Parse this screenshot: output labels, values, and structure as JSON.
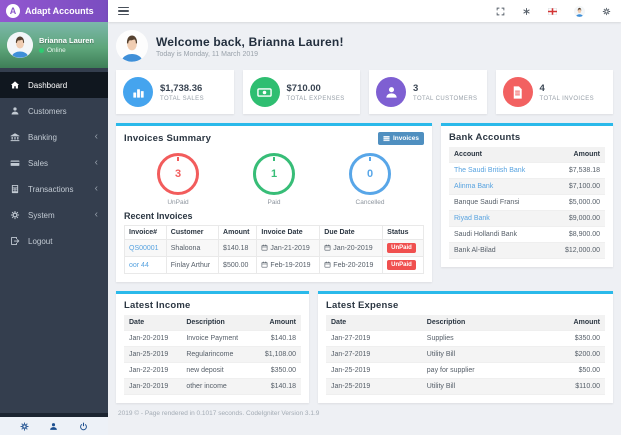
{
  "app": {
    "title": "Adapt Accounts"
  },
  "sidebar": {
    "user": {
      "name": "Brianna Lauren",
      "status": "Online"
    },
    "items": [
      {
        "label": "Dashboard"
      },
      {
        "label": "Customers"
      },
      {
        "label": "Banking",
        "chevron": "‹"
      },
      {
        "label": "Sales",
        "chevron": "‹"
      },
      {
        "label": "Transactions",
        "chevron": "‹"
      },
      {
        "label": "System",
        "chevron": "‹"
      },
      {
        "label": "Logout"
      }
    ],
    "footer_icons": [
      "gear-icon",
      "user-icon",
      "power-icon"
    ]
  },
  "topbar": {
    "icons": [
      "fullscreen-icon",
      "asterisk-icon",
      "flag-icon",
      "avatar-icon",
      "gear-icon"
    ]
  },
  "welcome": {
    "title": "Welcome back, Brianna Lauren!",
    "subtitle": "Today is Monday, 11 March 2019"
  },
  "stats": [
    {
      "value": "$1,738.36",
      "label": "TOTAL SALES",
      "color": "#45a4ee",
      "icon": "bar-chart-icon"
    },
    {
      "value": "$710.00",
      "label": "TOTAL EXPENSES",
      "color": "#2fbe71",
      "icon": "money-icon"
    },
    {
      "value": "3",
      "label": "TOTAL CUSTOMERS",
      "color": "#7e5fd2",
      "icon": "user-icon"
    },
    {
      "value": "4",
      "label": "TOTAL INVOICES",
      "color": "#f26161",
      "icon": "invoice-icon"
    }
  ],
  "invoices_summary": {
    "title": "Invoices Summary",
    "button_label": "Invoices",
    "dials": [
      {
        "value": "3",
        "label": "UnPaid",
        "color": "#f25c5c"
      },
      {
        "value": "1",
        "label": "Paid",
        "color": "#37bd77"
      },
      {
        "value": "0",
        "label": "Cancelled",
        "color": "#58a6e8"
      }
    ],
    "recent_title": "Recent Invoices",
    "headers": [
      "Invoice#",
      "Customer",
      "Amount",
      "Invoice Date",
      "Due Date",
      "Status"
    ],
    "rows": [
      {
        "invoice": "QS00001",
        "customer": "Shaloona",
        "amount": "$140.18",
        "invoice_date": "Jan-21-2019",
        "due_date": "Jan-20-2019",
        "status": "UnPaid"
      },
      {
        "invoice": "oor 44",
        "customer": "Finlay Arthur",
        "amount": "$500.00",
        "invoice_date": "Feb-19-2019",
        "due_date": "Feb-20-2019",
        "status": "UnPaid"
      }
    ]
  },
  "bank_accounts": {
    "title": "Bank Accounts",
    "headers": [
      "Account",
      "Amount"
    ],
    "rows": [
      {
        "account": "The Saudi British Bank",
        "amount": "$7,538.18"
      },
      {
        "account": "Alinma Bank",
        "amount": "$7,100.00"
      },
      {
        "account": "Banque Saudi Fransi",
        "amount": "$5,000.00"
      },
      {
        "account": "Riyad Bank",
        "amount": "$9,000.00"
      },
      {
        "account": "Saudi Hollandi Bank",
        "amount": "$8,900.00"
      },
      {
        "account": "Bank Al-Bilad",
        "amount": "$12,000.00"
      }
    ]
  },
  "latest_income": {
    "title": "Latest Income",
    "headers": [
      "Date",
      "Description",
      "Amount"
    ],
    "rows": [
      {
        "date": "Jan-20-2019",
        "description": "Invoice Payment",
        "amount": "$140.18"
      },
      {
        "date": "Jan-25-2019",
        "description": "Regularincome",
        "amount": "$1,108.00"
      },
      {
        "date": "Jan-22-2019",
        "description": "new deposit",
        "amount": "$350.00"
      },
      {
        "date": "Jan-20-2019",
        "description": "other income",
        "amount": "$140.18"
      }
    ]
  },
  "latest_expense": {
    "title": "Latest Expense",
    "headers": [
      "Date",
      "Description",
      "Amount"
    ],
    "rows": [
      {
        "date": "Jan-27-2019",
        "description": "Supplies",
        "amount": "$350.00"
      },
      {
        "date": "Jan-27-2019",
        "description": "Utility Bill",
        "amount": "$200.00"
      },
      {
        "date": "Jan-25-2019",
        "description": "pay for supplier",
        "amount": "$50.00"
      },
      {
        "date": "Jan-25-2019",
        "description": "Utility Bill",
        "amount": "$110.00"
      }
    ]
  },
  "footer": {
    "text": "2019 © - Page rendered in 0.1017 seconds. CodeIgniter Version 3.1.9"
  },
  "colors": {
    "accent_bar": "#2ab9ea",
    "link": "#58a3e0",
    "unpaid_badge": "#f0504f",
    "brand_purple": "#8a56c9",
    "sidebar_bg": "#343e4e",
    "active_item_bg": "#10171f"
  }
}
